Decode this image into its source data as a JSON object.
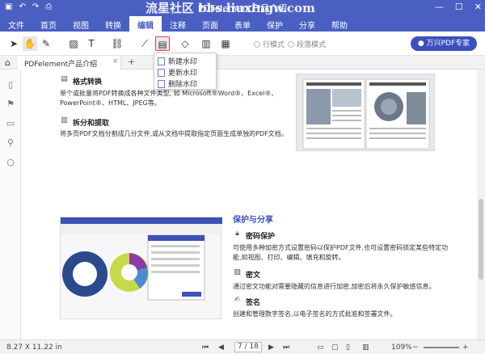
{
  "titlebar": {
    "title": "PDFelement产品介绍",
    "watermark": "流星社区 bbs.liuxingw.com",
    "quick_icons": [
      "save-icon",
      "undo-icon",
      "redo-icon",
      "print-icon"
    ]
  },
  "menu": [
    "文件",
    "首页",
    "视图",
    "转换",
    "编辑",
    "注释",
    "页面",
    "表单",
    "保护",
    "分享",
    "帮助"
  ],
  "menu_active": "编辑",
  "toolbar": {
    "mode_line": "行模式",
    "mode_paragraph": "段落模式",
    "expert_button": "万兴PDF专家"
  },
  "tab": {
    "label": "PDFelement产品介绍",
    "close": "×",
    "add": "+"
  },
  "watermark_menu": {
    "items": [
      "新建水印",
      "更新水印",
      "删除水印"
    ]
  },
  "page": {
    "sec1_title": "格式转换",
    "sec1_line1": "单个或批量将PDF转换成各种文件类型, 如 Microsoft®Word®、Excel®、",
    "sec1_line2": "PowerPoint®、HTML、JPEG等。",
    "sec2_title": "拆分和提取",
    "sec2_line1": "将多页PDF文档分割成几分文件,或从文档中提取指定页面生成单独的PDF文档。",
    "protect_title": "保护与分享",
    "pw_title": "密码保护",
    "pw_line1": "可使用多种加密方式设置密码以保护PDF文件,也可设置密码锁定某些特定功",
    "pw_line2": "能,如视图、打印、编辑、填充和旋转。",
    "redact_title": "密文",
    "redact_line1": "通过密文功能对需要隐藏的信息进行加密,加密后将永久保护敏感信息。",
    "sign_title": "签名",
    "sign_line1": "创建和管理数字签名,以电子签名的方式批准和签署文件。"
  },
  "status": {
    "size": "8.27 X 11.22 in",
    "page_current": "7",
    "page_total": "/ 18",
    "zoom": "109%"
  },
  "colors": {
    "brand": "#4a5fc1",
    "button": "#3d4fbf",
    "highlight_border": "#e43b3b"
  }
}
